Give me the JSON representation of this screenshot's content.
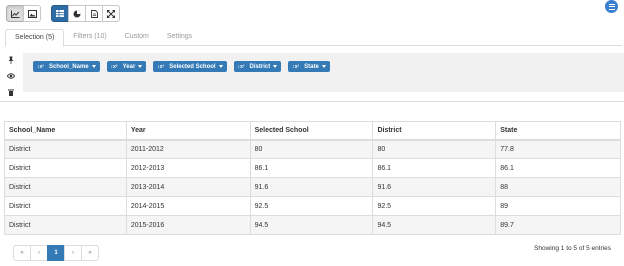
{
  "toolbar": {
    "viz_buttons": [
      {
        "icon": "line-chart-icon",
        "active": true
      },
      {
        "icon": "image-icon",
        "active": false
      }
    ],
    "view_buttons": [
      {
        "icon": "table-icon",
        "active": true
      },
      {
        "icon": "pie-chart-icon",
        "active": false
      },
      {
        "icon": "document-icon",
        "active": false
      },
      {
        "icon": "expand-icon",
        "active": false
      }
    ],
    "menu_icon": "menu-icon",
    "accent_color": "#2e6da4"
  },
  "tabs": [
    {
      "label": "Selection (5)",
      "active": true
    },
    {
      "label": "Filters (10)",
      "active": false
    },
    {
      "label": "Custom",
      "active": false
    },
    {
      "label": "Settings",
      "active": false
    }
  ],
  "selection": {
    "side_icons": [
      "pin-icon",
      "eye-icon",
      "trash-icon"
    ],
    "tag_icon": "↕x²",
    "tags": [
      {
        "label": "School_Name"
      },
      {
        "label": "Year"
      },
      {
        "label": "Selected School"
      },
      {
        "label": "District"
      },
      {
        "label": "State"
      }
    ],
    "tag_color": "#337ab7"
  },
  "table": {
    "columns": [
      "School_Name",
      "Year",
      "Selected School",
      "District",
      "State"
    ],
    "rows": [
      [
        "District",
        "2011-2012",
        "80",
        "80",
        "77.8"
      ],
      [
        "District",
        "2012-2013",
        "86.1",
        "86.1",
        "86.1"
      ],
      [
        "District",
        "2013-2014",
        "91.6",
        "91.6",
        "88"
      ],
      [
        "District",
        "2014-2015",
        "92.5",
        "92.5",
        "89"
      ],
      [
        "District",
        "2015-2016",
        "94.5",
        "94.5",
        "89.7"
      ]
    ]
  },
  "pagination": {
    "first": "«",
    "prev": "‹",
    "current": "1",
    "next": "›",
    "last": "»",
    "info": "Showing 1 to 5 of 5 entries"
  }
}
